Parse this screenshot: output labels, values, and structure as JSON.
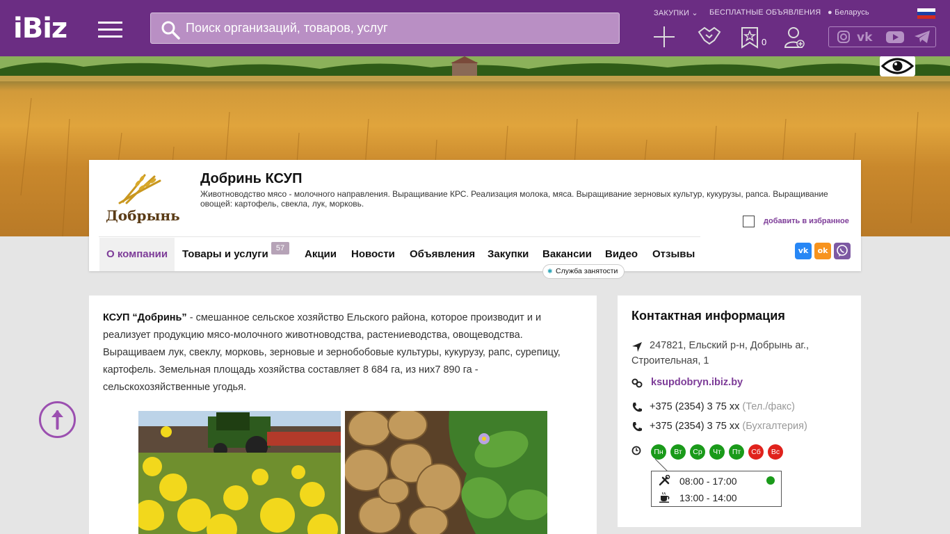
{
  "header": {
    "logo": "iBiz",
    "search_placeholder": "Поиск организаций, товаров, услуг",
    "links": {
      "purchases": "ЗАКУПКИ",
      "free_ads": "БЕСПЛАТНЫЕ ОБЪЯВЛЕНИЯ",
      "region": "Беларусь"
    },
    "favorites_count": "0"
  },
  "company": {
    "logo_text": "Добрынь",
    "title": "Добринь КСУП",
    "description": "Животноводство мясо - молочного направления. Выращивание КРС. Реализация молока, мяса. Выращивание зерновых культур, кукурузы, рапса. Выращивание овощей: картофель, свекла, лук, морковь.",
    "add_favorite": "добавить в избранное"
  },
  "tabs": [
    {
      "label": "О компании"
    },
    {
      "label": "Товары и услуги",
      "badge": "57"
    },
    {
      "label": "Акции"
    },
    {
      "label": "Новости"
    },
    {
      "label": "Объявления"
    },
    {
      "label": "Закупки"
    },
    {
      "label": "Вакансии"
    },
    {
      "label": "Видео"
    },
    {
      "label": "Отзывы"
    }
  ],
  "employment_service": "Служба занятости",
  "share": {
    "vk": "vk",
    "ok": "ok"
  },
  "about": {
    "name": "КСУП “Добринь”",
    "text": " - смешанное сельское хозяйство Ельского района, которое производит и и реализует продукцию мясо-молочного животноводства, растениеводства, овощеводства. Выращиваем лук, свеклу, морковь, зерновые и зернобобовые культуры, кукурузу, рапс, сурепицу, картофель. Земельная площадь хозяйства составляет 8 684 га, из них7 890 га - сельскохозяйственные угодья."
  },
  "contacts": {
    "title": "Контактная информация",
    "address": "247821, Ельский р-н, Добрынь аг., Строительная, 1",
    "address_line1": "247821, Ельский р-н, Добрынь аг.,",
    "address_line2": "Строительная, 1",
    "website": "ksupdobryn.ibiz.by",
    "phones": [
      {
        "number": "+375 (2354) 3 75 xx",
        "note": "(Тел./факс)"
      },
      {
        "number": "+375 (2354) 3 75 xx",
        "note": "(Бухгалтерия)"
      }
    ],
    "days": [
      {
        "label": "Пн",
        "color": "#1a9a1a"
      },
      {
        "label": "Вт",
        "color": "#1a9a1a"
      },
      {
        "label": "Ср",
        "color": "#1a9a1a"
      },
      {
        "label": "Чт",
        "color": "#1a9a1a"
      },
      {
        "label": "Пт",
        "color": "#1a9a1a"
      },
      {
        "label": "Сб",
        "color": "#e0221c"
      },
      {
        "label": "Вс",
        "color": "#e0221c"
      }
    ],
    "work_hours": "08:00 - 17:00",
    "break_hours": "13:00 - 14:00"
  },
  "colors": {
    "brand": "#6b2d83",
    "accent": "#7d3c98",
    "open": "#1a9a1a",
    "closed": "#e0221c"
  }
}
